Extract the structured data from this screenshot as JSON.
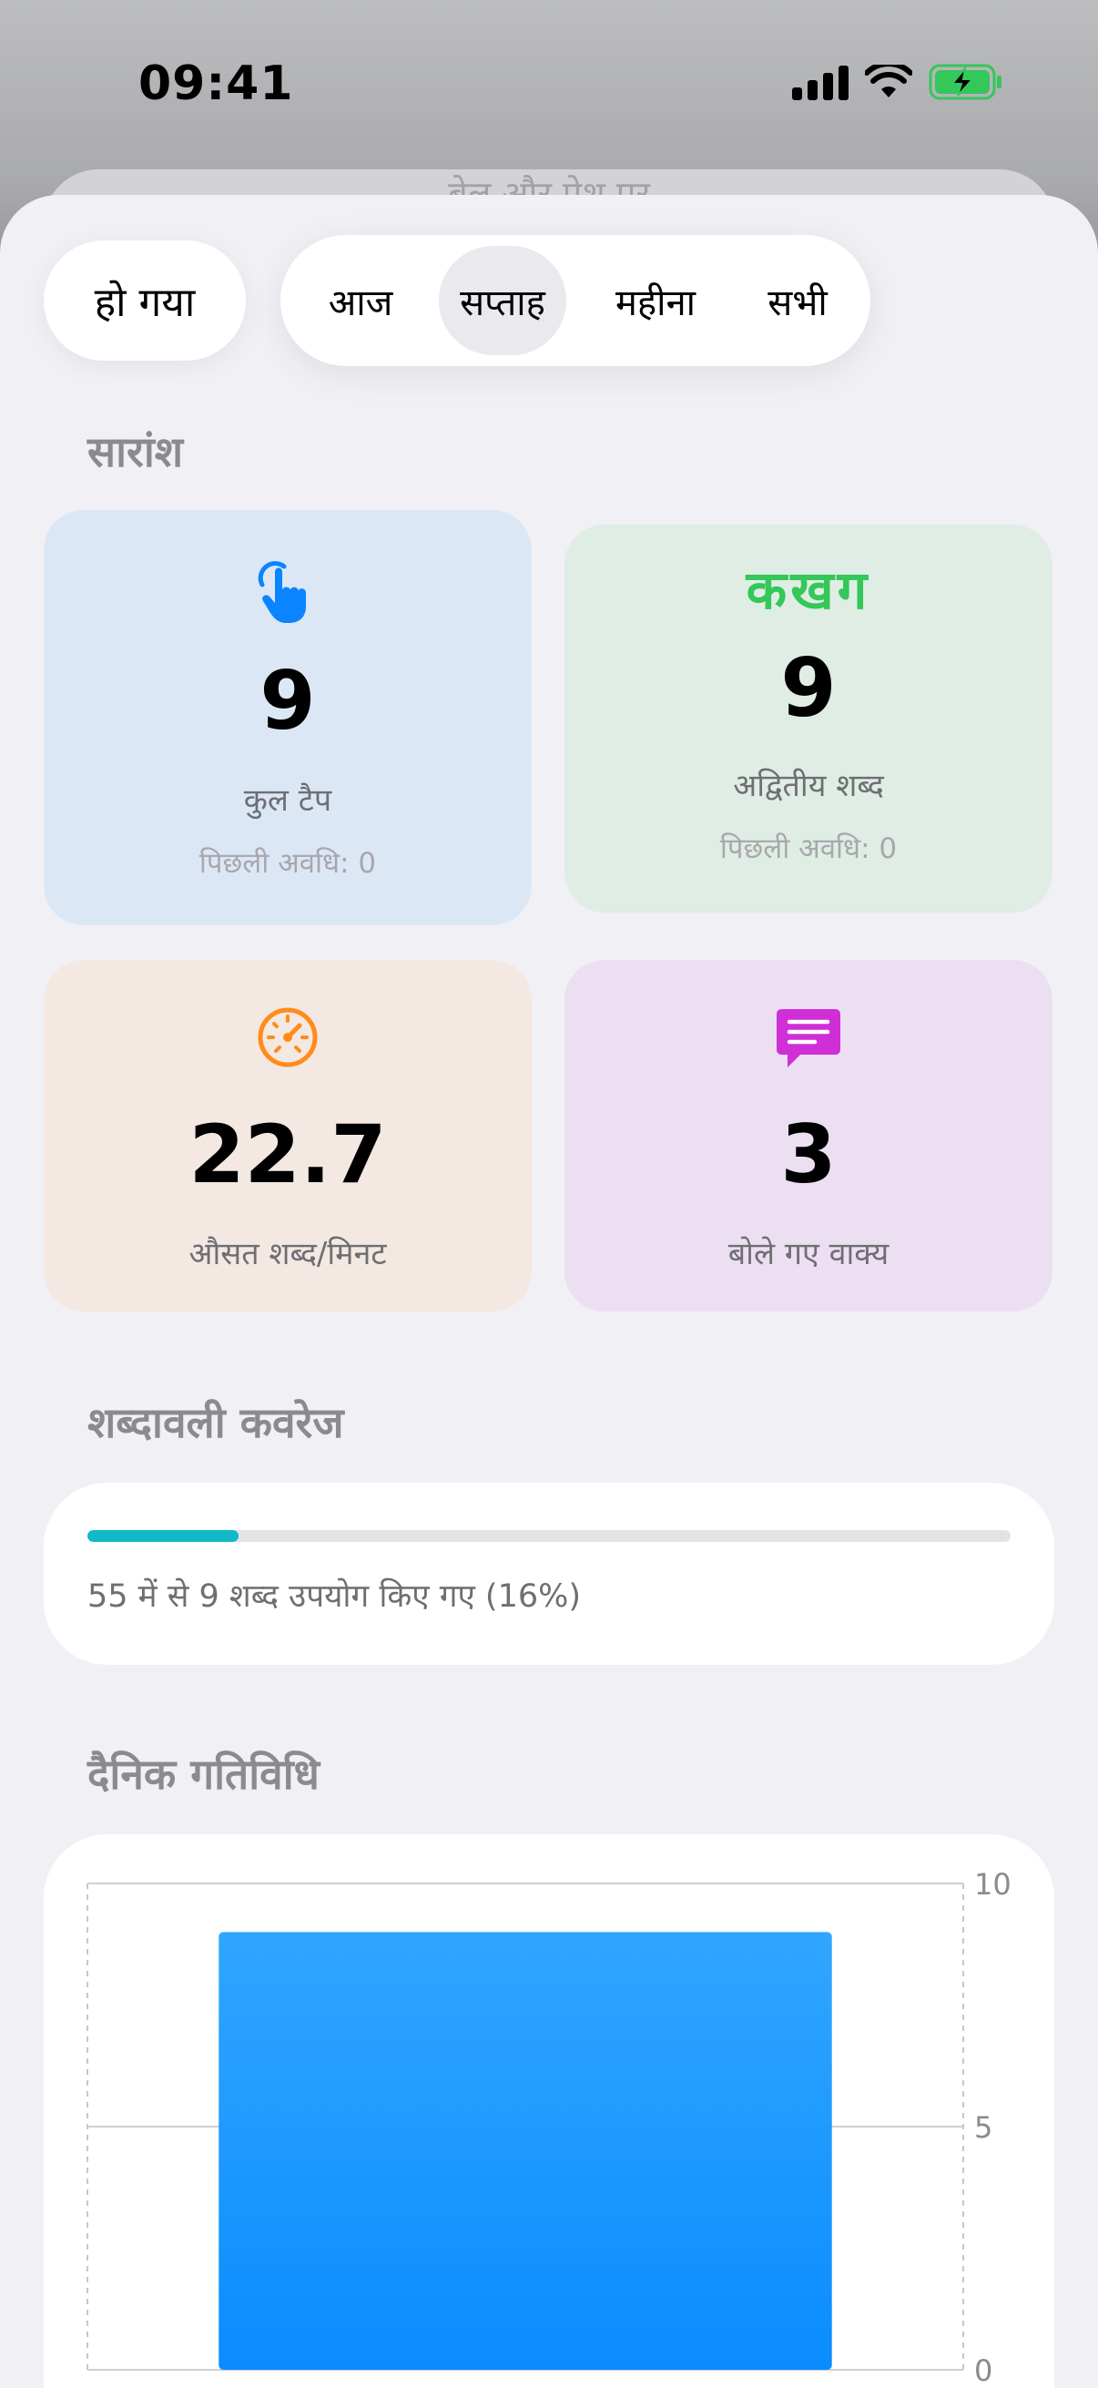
{
  "status_bar": {
    "time": "09:41"
  },
  "back_sheet": {
    "title": "बेल और ऐश पर"
  },
  "header": {
    "done_label": "हो गया",
    "segments": [
      "आज",
      "सप्ताह",
      "महीना",
      "सभी"
    ],
    "selected_segment": "सप्ताह"
  },
  "summary": {
    "title": "सारांश",
    "cards": [
      {
        "icon": "hand-tap-icon",
        "value": "9",
        "label": "कुल टैप",
        "sub": "पिछली अवधि: 0",
        "bg": "#dce7f6"
      },
      {
        "icon": "devanagari-letters-icon",
        "icon_text": "कखग",
        "value": "9",
        "label": "अद्वितीय शब्द",
        "sub": "पिछली अवधि: 0",
        "bg": "#dfede4"
      },
      {
        "icon": "speedometer-icon",
        "value": "22.7",
        "label": "औसत शब्द/मिनट",
        "bg": "#f3e8e2"
      },
      {
        "icon": "message-bubble-icon",
        "value": "3",
        "label": "बोले गए वाक्य",
        "bg": "#ecdff2"
      }
    ]
  },
  "coverage": {
    "title": "शब्दावली कवरेज",
    "used": 9,
    "total": 55,
    "percent": 16,
    "text": "55 में से 9 शब्द उपयोग किए गए (16%)",
    "color": "#12b8c6"
  },
  "activity": {
    "title": "दैनिक गतिविधि"
  },
  "chart_data": {
    "type": "bar",
    "categories": [
      ""
    ],
    "values": [
      9
    ],
    "ylim": [
      0,
      10
    ],
    "yticks": [
      "0",
      "5",
      "10"
    ],
    "grid": true,
    "bar_color": "#0a8cff"
  }
}
